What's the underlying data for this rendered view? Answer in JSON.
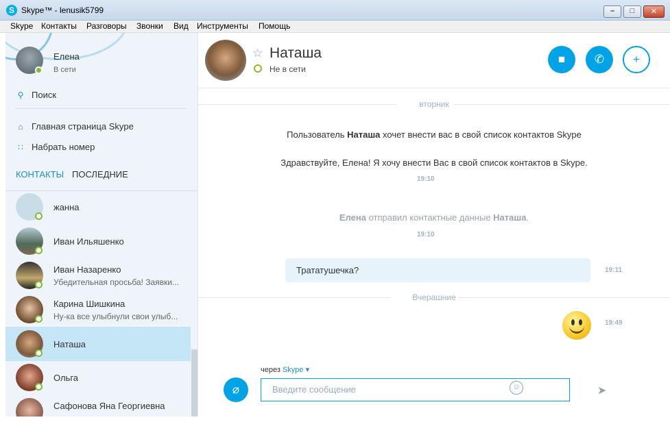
{
  "window": {
    "title": "Skype™ - lenusik5799",
    "logo_letter": "S",
    "min": "–",
    "max": "□",
    "close": "✕"
  },
  "menu": [
    "Skype",
    "Контакты",
    "Разговоры",
    "Звонки",
    "Вид",
    "Инструменты",
    "Помощь"
  ],
  "me": {
    "name": "Елена",
    "status": "В сети"
  },
  "sidebar": {
    "search": "Поиск",
    "home": "Главная страница Skype",
    "dial": "Набрать номер",
    "tabs": {
      "contacts": "КОНТАКТЫ",
      "recent": "ПОСЛЕДНИЕ"
    }
  },
  "contacts": [
    {
      "name": "жанна",
      "message": ""
    },
    {
      "name": "Иван Ильяшенко",
      "message": ""
    },
    {
      "name": "Иван Назаренко",
      "message": "Убедительная просьба! Заявки..."
    },
    {
      "name": "Карина Шишкина",
      "message": "Ну-ка все улыбнули свои улыб..."
    },
    {
      "name": "Наташа",
      "message": ""
    },
    {
      "name": "Ольга",
      "message": ""
    },
    {
      "name": "Сафонова Яна Георгиевна",
      "message": ""
    }
  ],
  "chat": {
    "name": "Наташа",
    "status": "Не в сети",
    "day1": "вторник",
    "sys1_prefix": "Пользователь ",
    "sys1_name": "Наташа",
    "sys1_suffix": " хочет внести вас в свой список контактов Skype",
    "sys1_text": "Здравствуйте, Елена! Я хочу внести Вас в свой список контактов в Skype.",
    "time1": "19:10",
    "sys2_name1": "Елена",
    "sys2_mid": " отправил контактные данные ",
    "sys2_name2": "Наташа",
    "sys2_end": ".",
    "time2": "19:10",
    "bubble": "Тратат​ушечка?",
    "time3": "19:11",
    "day2": "Вчерашние",
    "time4": "19:49",
    "via_prefix": "через ",
    "via_service": "Skype ▾",
    "input_placeholder": "Введите сообщение"
  },
  "colors": {
    "accent": "#00a3e6",
    "online": "#7bbf2c",
    "selected": "#c5e6f7"
  }
}
